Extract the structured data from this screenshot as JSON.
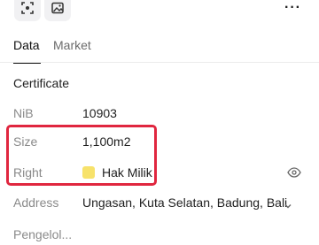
{
  "toolbar": {
    "icons": [
      "scan-icon",
      "image-icon"
    ],
    "more_label": "···"
  },
  "tabs": [
    {
      "label": "Data",
      "active": true
    },
    {
      "label": "Market",
      "active": false
    }
  ],
  "section": {
    "title": "Certificate"
  },
  "fields": {
    "nib": {
      "label": "NiB",
      "value": "10903"
    },
    "size": {
      "label": "Size",
      "value": "1,100m2"
    },
    "right": {
      "label": "Right",
      "value": "Hak Milik",
      "swatch_color": "#f7e26b"
    },
    "address": {
      "label": "Address",
      "value": "Ungasan, Kuta Selatan, Badung, Bali"
    },
    "pengelola": {
      "label": "Pengelol..."
    }
  },
  "colors": {
    "highlight": "#e0263f",
    "accent_text": "#111111",
    "muted_text": "#8a8a8a"
  }
}
